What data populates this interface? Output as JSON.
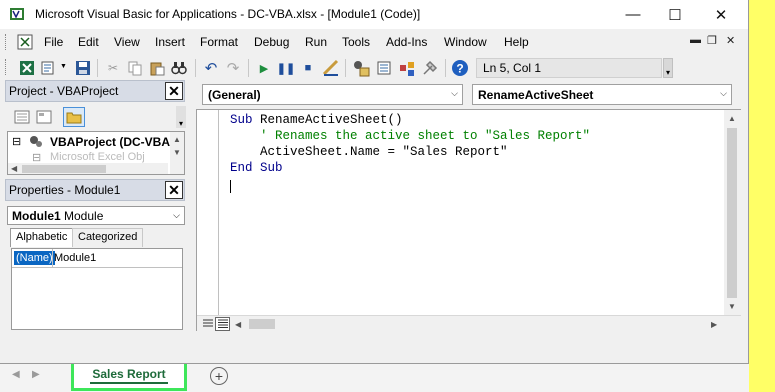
{
  "window": {
    "title": "Microsoft Visual Basic for Applications - DC-VBA.xlsx - [Module1 (Code)]",
    "minimize": "—",
    "maximize": "☐",
    "close": "✕"
  },
  "menu": {
    "items": [
      "File",
      "Edit",
      "View",
      "Insert",
      "Format",
      "Debug",
      "Run",
      "Tools",
      "Add-Ins",
      "Window",
      "Help"
    ],
    "mdi_minimize": "▬",
    "mdi_restore": "❐",
    "mdi_close": "✕"
  },
  "toolbar": {
    "position": "Ln 5, Col 1",
    "icons": [
      "excel-icon",
      "insert-module-icon",
      "save-icon",
      "cut-icon",
      "copy-icon",
      "paste-icon",
      "find-icon",
      "undo-icon",
      "redo-icon",
      "run-icon",
      "break-icon",
      "reset-icon",
      "design-mode-icon",
      "project-explorer-icon",
      "properties-icon",
      "object-browser-icon",
      "toolbox-icon",
      "help-icon"
    ]
  },
  "project_pane": {
    "title": "Project - VBAProject",
    "close": "✕",
    "tree_root": "VBAProject (DC-VBA.",
    "tree_child": "Microsoft Excel Obj"
  },
  "properties_pane": {
    "title": "Properties - Module1",
    "close": "✕",
    "object_name": "Module1",
    "object_type": "Module",
    "tabs": [
      "Alphabetic",
      "Categorized"
    ],
    "property_name": "(Name)",
    "property_value": "Module1"
  },
  "code_window": {
    "object_combo": "(General)",
    "procedure_combo": "RenameActiveSheet",
    "lines": [
      {
        "kw": "Sub",
        "text": " RenameActiveSheet()"
      },
      {
        "comment": "    ' Renames the active sheet to \"Sales Report\""
      },
      {
        "text": "    ActiveSheet.Name = \"Sales Report\""
      },
      {
        "kw": "End Sub",
        "text": ""
      }
    ]
  },
  "excel": {
    "sheet_tab": "Sales Report",
    "add_sheet": "+",
    "nav_prev": "◀",
    "nav_next": "▶"
  },
  "colors": {
    "tab_highlight": "#3ee65a",
    "tab_text": "#1e6b3a",
    "keyword": "#00008b",
    "comment": "#008000",
    "pane_header": "#d7dce6",
    "yellow_strip": "#ffff66"
  }
}
